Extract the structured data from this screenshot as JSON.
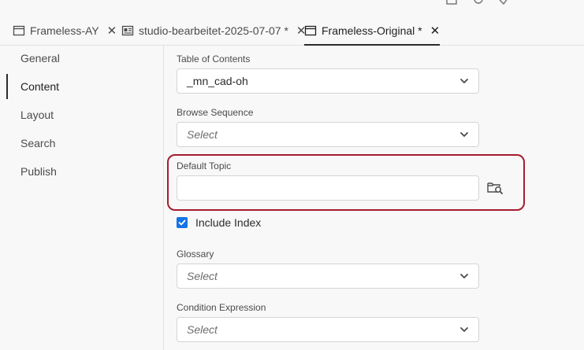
{
  "tabs": [
    {
      "label": "Frameless-AY",
      "icon": "window-icon",
      "active": false
    },
    {
      "label": "studio-bearbeitet-2025-07-07 *",
      "icon": "document-layout-icon",
      "active": false
    },
    {
      "label": "Frameless-Original *",
      "icon": "window-icon",
      "active": true
    }
  ],
  "tab_close_glyph": "✕",
  "sidebar": {
    "items": [
      {
        "label": "General"
      },
      {
        "label": "Content"
      },
      {
        "label": "Layout"
      },
      {
        "label": "Search"
      },
      {
        "label": "Publish"
      }
    ],
    "active": "Content"
  },
  "form": {
    "toc": {
      "label": "Table of Contents",
      "value": "_mn_cad-oh"
    },
    "browse_sequence": {
      "label": "Browse Sequence",
      "value": "Select"
    },
    "default_topic": {
      "label": "Default Topic",
      "value": ""
    },
    "include_index": {
      "label": "Include Index",
      "checked": true
    },
    "glossary": {
      "label": "Glossary",
      "value": "Select"
    },
    "condition_expression": {
      "label": "Condition Expression",
      "value": "Select"
    }
  },
  "colors": {
    "accent": "#1473e6",
    "highlight": "#a51d2d",
    "background": "#f8f8f8"
  }
}
